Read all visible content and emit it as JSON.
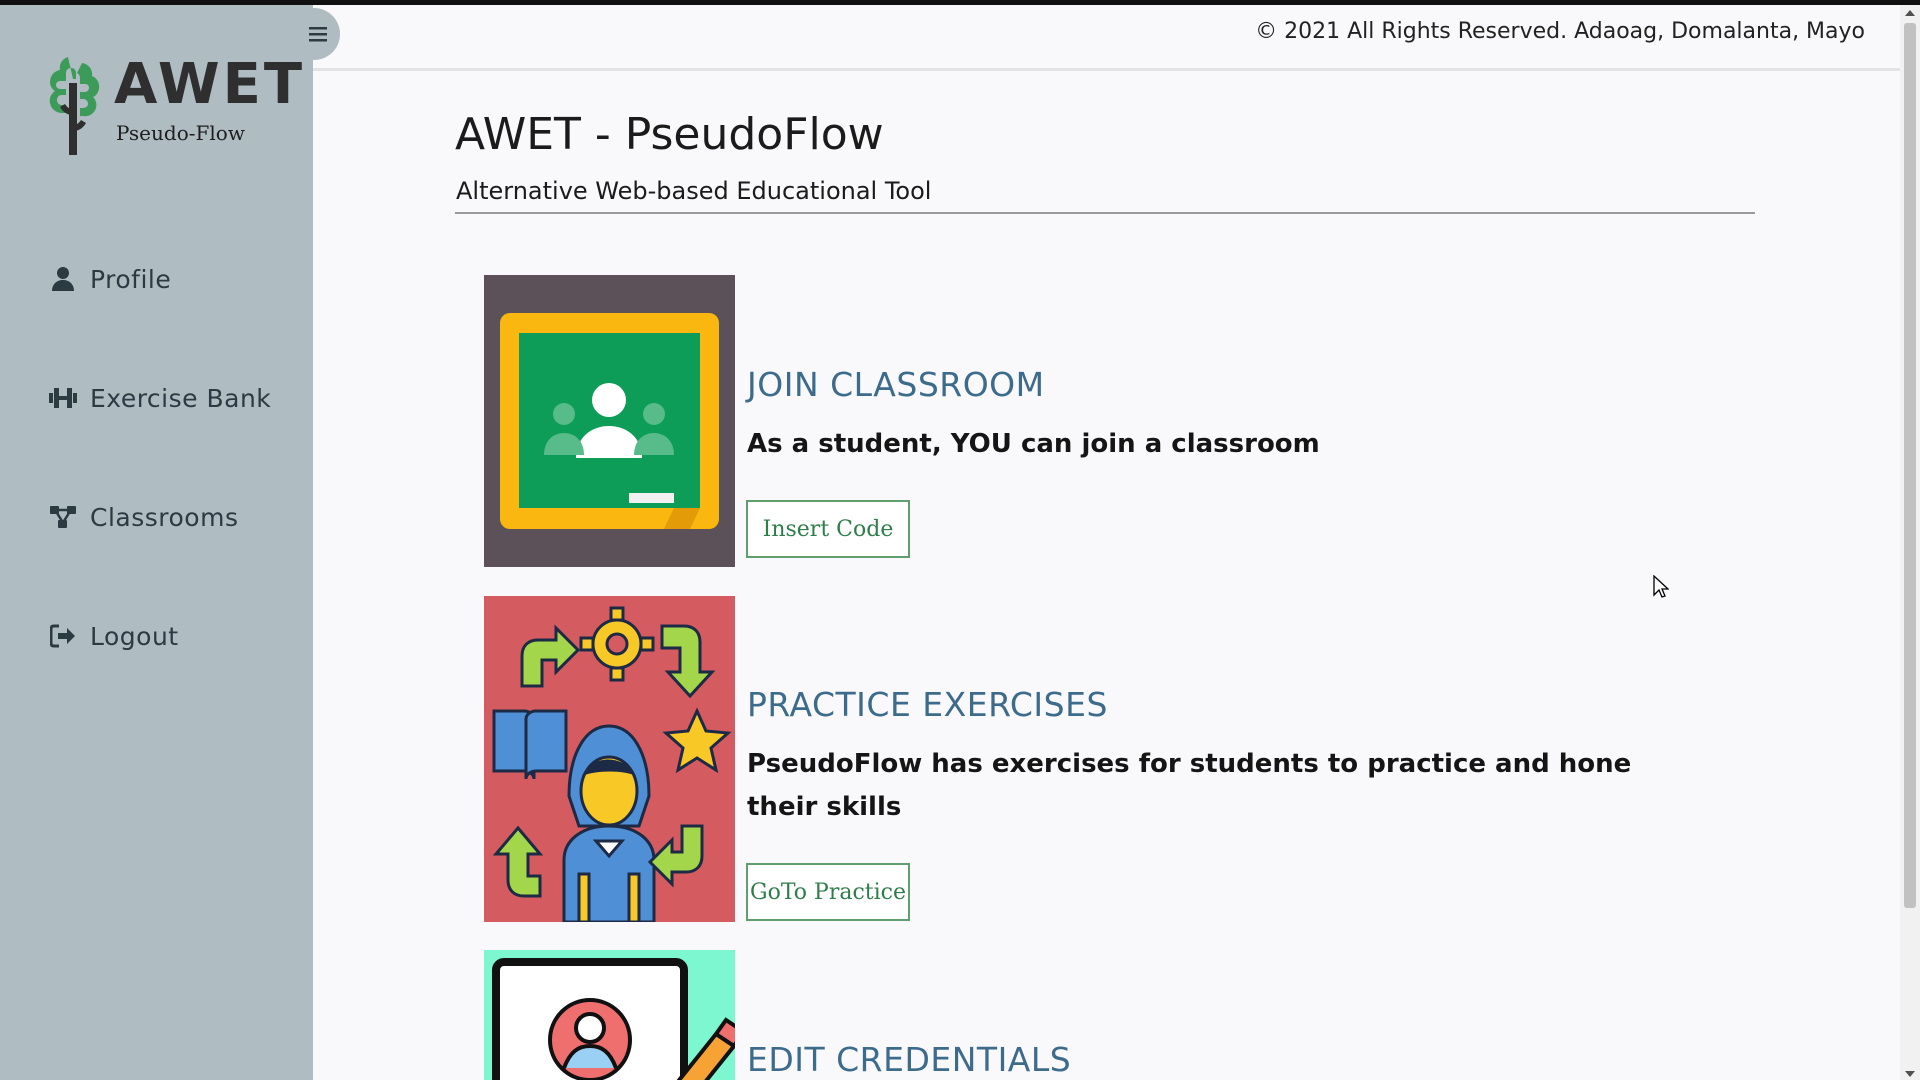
{
  "app": {
    "logo_title": "AWET",
    "logo_subtitle": "Pseudo-Flow"
  },
  "sidebar": {
    "toggle_icon": "hamburger-icon",
    "items": [
      {
        "label": "Profile",
        "icon": "user-icon"
      },
      {
        "label": "Exercise Bank",
        "icon": "dumbbell-icon"
      },
      {
        "label": "Classrooms",
        "icon": "network-icon"
      },
      {
        "label": "Logout",
        "icon": "sign-out-icon"
      }
    ]
  },
  "header": {
    "copyright": "© 2021 All Rights Reserved. Adaoag, Domalanta, Mayo"
  },
  "main": {
    "title": "AWET - PseudoFlow",
    "subtitle": "Alternative Web-based Educational Tool",
    "cards": [
      {
        "heading": "JOIN CLASSROOM",
        "description": "As a student, YOU can join a classroom",
        "button": "Insert Code",
        "image": "google-classroom-image"
      },
      {
        "heading": "PRACTICE EXERCISES",
        "description": "PseudoFlow has exercises for students to practice and hone their skills",
        "button": "GoTo Practice",
        "image": "student-learning-image"
      },
      {
        "heading": "EDIT CREDENTIALS",
        "image": "edit-profile-image"
      }
    ]
  },
  "colors": {
    "sidebar_bg": "#afbcc2",
    "main_bg": "#f9f9fb",
    "heading_blue": "#3d6b8c",
    "button_green": "#2f7d4a",
    "logo_green": "#3d9b5a"
  }
}
